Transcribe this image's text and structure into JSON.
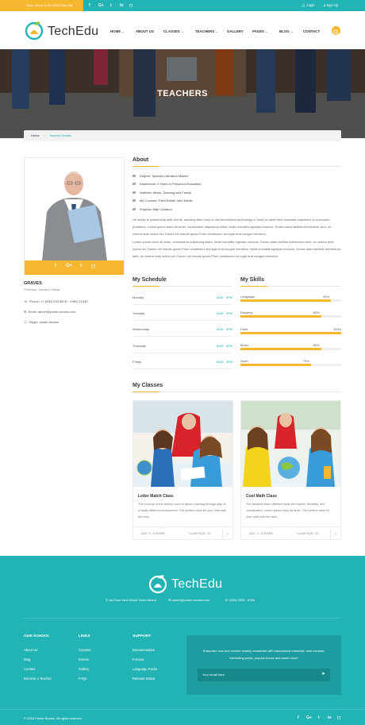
{
  "topbar": {
    "open_hours": "Open hours: 8:00-18:00 Mon-Sat",
    "login": "Login",
    "signup": "Sign Up"
  },
  "brand": {
    "name": "TechEdu",
    "accent": "#f5b72d",
    "teal": "#22b3b5"
  },
  "nav": {
    "items": [
      "HOME",
      "ABOUT US",
      "CLASSES",
      "TEACHERS",
      "GALLERY",
      "PAGES",
      "BLOG",
      "CONTACT"
    ]
  },
  "hero": {
    "title": "TEACHERS"
  },
  "breadcrumb": {
    "home": "Home",
    "current": "Teacher Details"
  },
  "teacher": {
    "name": "GRAVES",
    "role": "Professor, Harvard College",
    "phone": "Phone: +1 (000) 234 5678 / +0800 12345",
    "email": "Email: admin@power-boosts.com",
    "skype": "Skype: power-boosts"
  },
  "about": {
    "heading": "About",
    "degree": "Degree: Spanish Literature Master",
    "experience": "Experience: 5 Years in Preschool Education",
    "hobbies": "Hobbies: Music, Dancing and Family",
    "courses": "My Courses: Paint Kiddie, Mini Kiddie",
    "projects": "Projects: Map Creation",
    "para1": "He works in partnership with clients, advising them how to use information technology in order to meet their business objectives or overcome problems. Lorem ipsum dolor sit amet, consectetur adipiscing elites. Nulla convallis egestas rhoncus. Donec iaam facilisis fermentum sem, ac viverra ante luctus vel. Donec vel mauris quam.Proin vestibulum leo eget erat congue interdum.",
    "para2": "Lorem ipsum dolor sit amet, consectetur adipiscing elites. Nulla convallis egestas rhoncus. Donec iaam facilisis fermentum sem, ac viverra ante luctus vel. Donec vel mauris quam.Proin vestibulum leo eget erat congue interdum. Nulla convallis egestas rhoncus. Donec iaam facilisis fermentum sem, ac viverra ante luctus vel. Donec vel mauris quam.Proin vestibulum leo eget erat congue interdum."
  },
  "schedule": {
    "heading": "My Schedule",
    "rows": [
      {
        "day": "Monday",
        "time": "8AM - 3PM"
      },
      {
        "day": "Tuesday",
        "time": "8AM - 3PM"
      },
      {
        "day": "Wednesday",
        "time": "8AM - 3PM"
      },
      {
        "day": "Thursday",
        "time": "8AM - 3PM"
      },
      {
        "day": "Friday",
        "time": "8AM - 3PM"
      }
    ]
  },
  "skills": {
    "heading": "My Skills",
    "items": [
      {
        "name": "Language",
        "percent_label": "90%",
        "percent": 90
      },
      {
        "name": "Drawing",
        "percent_label": "80%",
        "percent": 80
      },
      {
        "name": "Paint",
        "percent_label": "100%",
        "percent": 100
      },
      {
        "name": "Music",
        "percent_label": "80%",
        "percent": 80
      },
      {
        "name": "Sport",
        "percent_label": "70%",
        "percent": 70
      }
    ]
  },
  "classes": {
    "heading": "My Classes",
    "cards": [
      {
        "title": "Letter Match Class",
        "desc": "The concept of the activity room is about Learning through play, in a totally different environment. The perfect class for your child with the best.",
        "age": "AGE: 5 - 6 YEARS",
        "size": "CLASS SIZE: 25"
      },
      {
        "title": "Cool Math Class",
        "desc": "The students learn different skills like rhythm, flexibility, and coordination. Lorem ipsum dolor sit amet. The perfect class for your child with the best.",
        "age": "AGE: 4 - 5 YEARS",
        "size": "CLASS SIZE: 30"
      }
    ]
  },
  "footer": {
    "address": "1st Floor New World Tower Miami",
    "email": "admin@power-boosts.com",
    "phone": "(800) 2345 - 6789",
    "col1_heading": "OUR SCHOOL",
    "col1": [
      "About Us",
      "Blog",
      "Contact",
      "Become a Teacher"
    ],
    "col2_heading": "LINKS",
    "col2": [
      "Courses",
      "Events",
      "Gallery",
      "FAQs"
    ],
    "col3_heading": "SUPPORT",
    "col3": [
      "Documentation",
      "Forums",
      "Language Packs",
      "Release Status"
    ],
    "newsletter_text": "Subscribe now and receive weekly newsletter with educational materials, new courses, interesting posts, popular books and much more!",
    "newsletter_placeholder": "Your email here",
    "copyright": "© 2016 Power-Boosts. All rights reserved"
  }
}
